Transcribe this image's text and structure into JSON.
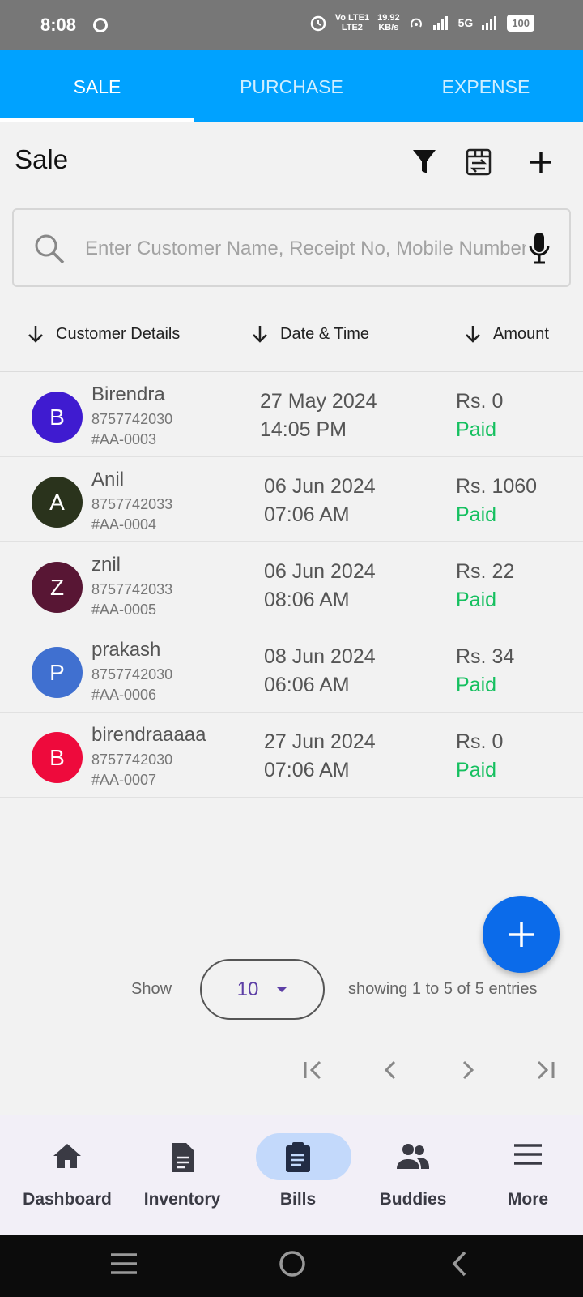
{
  "status_bar": {
    "time": "8:08",
    "net_top": "Vo LTE1",
    "net_bottom": "LTE2",
    "speed_top": "19.92",
    "speed_bottom": "KB/s",
    "network": "5G",
    "battery": "100"
  },
  "tabs": [
    {
      "label": "SALE",
      "active": true
    },
    {
      "label": "PURCHASE",
      "active": false
    },
    {
      "label": "EXPENSE",
      "active": false
    }
  ],
  "header": {
    "title": "Sale",
    "icons": [
      "filter-icon",
      "sync-box-icon",
      "plus-icon"
    ]
  },
  "search": {
    "placeholder": "Enter Customer Name, Receipt No, Mobile Number",
    "value": ""
  },
  "columns": [
    "Customer Details",
    "Date & Time",
    "Amount"
  ],
  "rows": [
    {
      "initial": "B",
      "avatar_color": "#3f1bd0",
      "name": "Birendra",
      "phone": "8757742030",
      "receipt": "#AA-0003",
      "date": "27 May 2024",
      "time": "14:05 PM",
      "amount": "Rs. 0",
      "status": "Paid"
    },
    {
      "initial": "A",
      "avatar_color": "#2a331c",
      "name": "Anil",
      "phone": "8757742033",
      "receipt": "#AA-0004",
      "date": "06 Jun 2024",
      "time": "07:06 AM",
      "amount": "Rs. 1060",
      "status": "Paid"
    },
    {
      "initial": "Z",
      "avatar_color": "#581634",
      "name": "znil",
      "phone": "8757742033",
      "receipt": "#AA-0005",
      "date": "06 Jun 2024",
      "time": "08:06 AM",
      "amount": "Rs. 22",
      "status": "Paid"
    },
    {
      "initial": "P",
      "avatar_color": "#4070d0",
      "name": "prakash",
      "phone": "8757742030",
      "receipt": "#AA-0006",
      "date": "08 Jun 2024",
      "time": "06:06 AM",
      "amount": "Rs. 34",
      "status": "Paid"
    },
    {
      "initial": "B",
      "avatar_color": "#ee0a3c",
      "name": "birendraaaaa",
      "phone": "8757742030",
      "receipt": "#AA-0007",
      "date": "27 Jun 2024",
      "time": "07:06 AM",
      "amount": "Rs. 0",
      "status": "Paid"
    }
  ],
  "pagination": {
    "show_label": "Show",
    "page_size": "10",
    "entries_text": "showing 1 to 5 of 5 entries"
  },
  "bottom_nav": [
    {
      "label": "Dashboard",
      "icon": "home-icon",
      "active": false
    },
    {
      "label": "Inventory",
      "icon": "document-icon",
      "active": false
    },
    {
      "label": "Bills",
      "icon": "clipboard-icon",
      "active": true
    },
    {
      "label": "Buddies",
      "icon": "people-icon",
      "active": false
    },
    {
      "label": "More",
      "icon": "menu-icon",
      "active": false
    }
  ],
  "colors": {
    "tab_bar": "#00a2ff",
    "fab": "#0b6bea",
    "paid": "#16c060",
    "active_nav": "#c3d9fb"
  }
}
